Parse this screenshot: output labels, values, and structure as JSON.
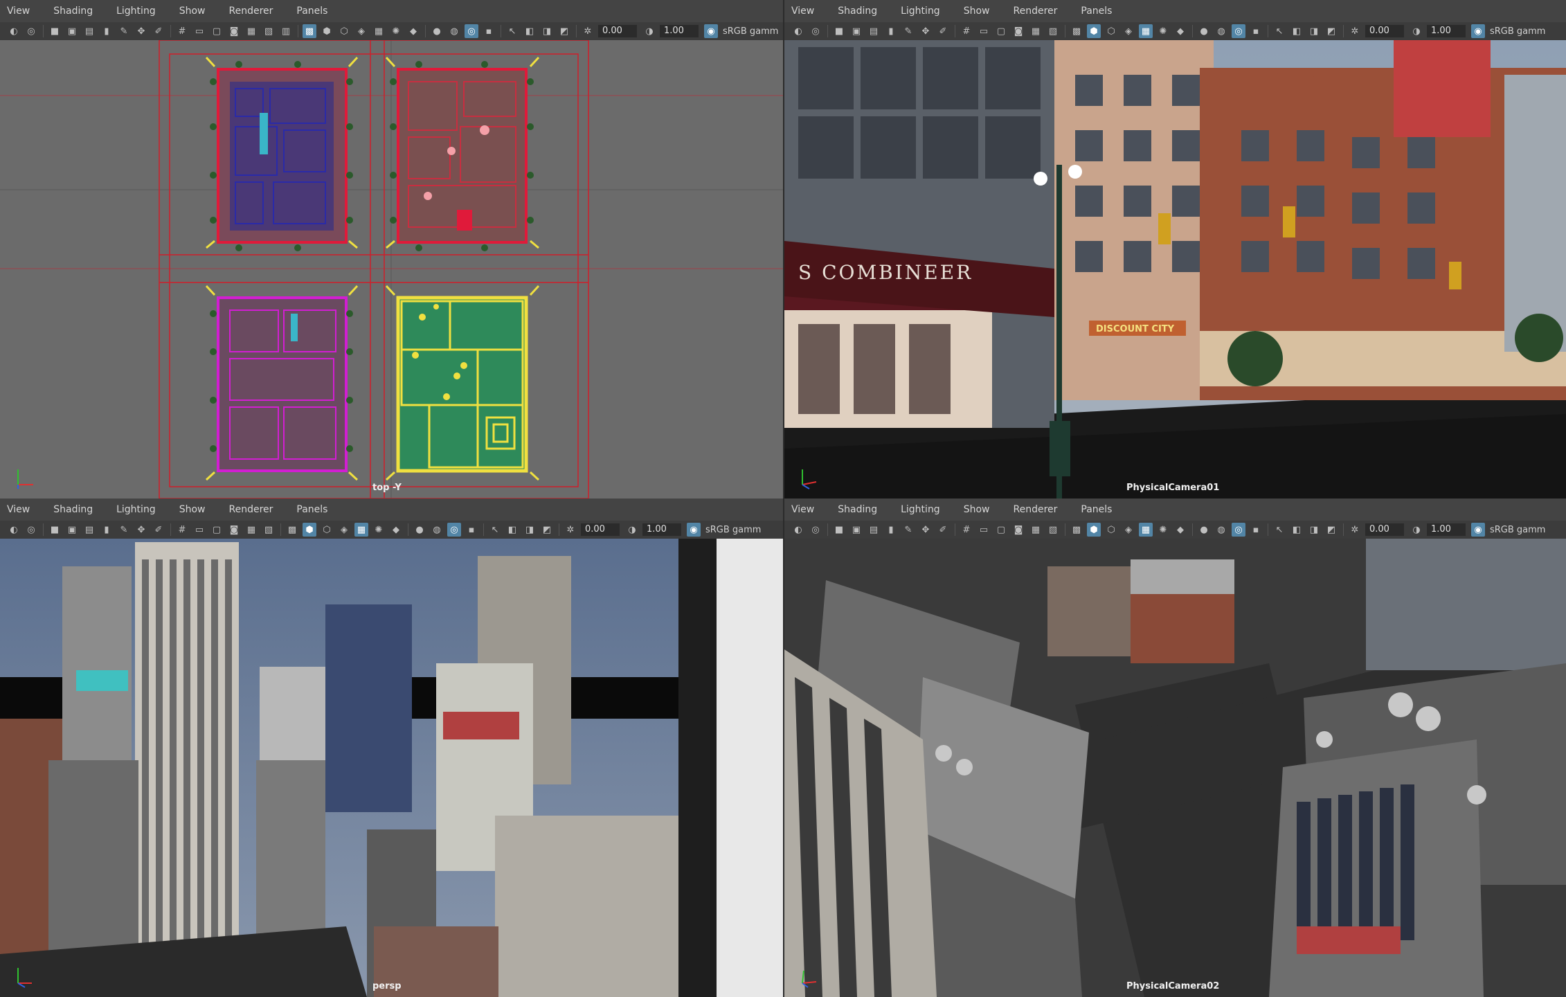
{
  "menus": [
    "View",
    "Shading",
    "Lighting",
    "Show",
    "Renderer",
    "Panels"
  ],
  "toolbar": {
    "exposure": "0.00",
    "gamma_value": "1.00",
    "color_space": "sRGB gamm"
  },
  "viewports": {
    "top_left": {
      "camera": "top -Y"
    },
    "top_right": {
      "camera": "PhysicalCamera01",
      "sign_text": "S COMBINEER",
      "shop_sign": "DISCOUNT CITY"
    },
    "bottom_left": {
      "camera": "persp"
    },
    "bottom_right": {
      "camera": "PhysicalCamera02"
    }
  },
  "axis_labels": {
    "x": "x",
    "y": "y",
    "z": "z"
  },
  "colors": {
    "viewport_grey": "#6b6b6b",
    "selection_red": "#d01e2a",
    "menubar": "#444444",
    "toolbar": "#3c3c3c",
    "accent_blue": "#5285a6"
  }
}
